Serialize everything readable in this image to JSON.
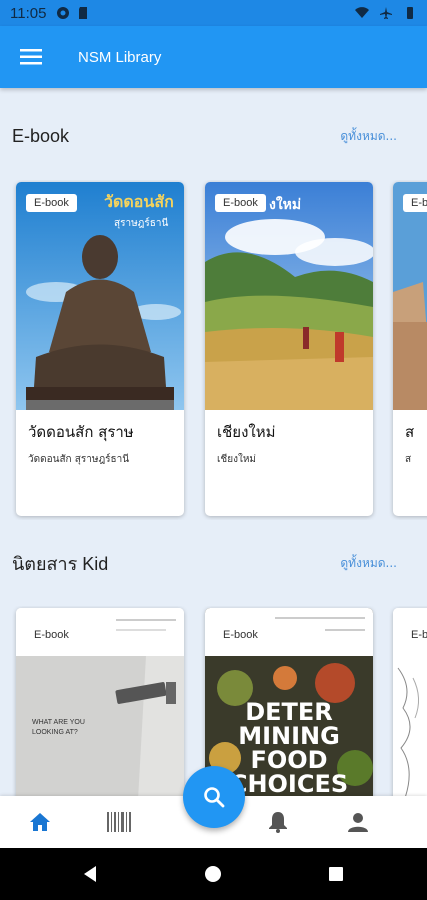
{
  "status": {
    "time": "11:05"
  },
  "app": {
    "title": "NSM Library"
  },
  "sections": [
    {
      "title": "E-book",
      "see_all": "ดูทั้งหมด...",
      "cards": [
        {
          "badge": "E-book",
          "title": "วัดดอนสัก สุราษ",
          "subtitle": "วัดดอนสัก สุราษฎร์ธานี",
          "cover_text": "วัดดอนสัก",
          "cover_sub": "สุราษฎร์ธานี"
        },
        {
          "badge": "E-book",
          "title": "เชียงใหม่",
          "subtitle": "เชียงใหม่",
          "cover_text": "งใหม่"
        },
        {
          "badge": "E-book",
          "title": "ส",
          "subtitle": "ส"
        }
      ]
    },
    {
      "title": "นิตยสาร Kid",
      "see_all": "ดูทั้งหมด...",
      "cards": [
        {
          "badge": "E-book",
          "cover_text": "WHAT ARE YOU LOOKING AT?"
        },
        {
          "badge": "E-book",
          "cover_text": "DETER MINING FOOD CHOICES"
        },
        {
          "badge": "E-book"
        }
      ]
    }
  ],
  "colors": {
    "primary": "#2196f3",
    "status": "#1e88e5",
    "active_nav": "#1976d2"
  },
  "bottom_nav": [
    "home-icon",
    "barcode-icon",
    "search-icon",
    "bell-icon",
    "person-icon"
  ]
}
